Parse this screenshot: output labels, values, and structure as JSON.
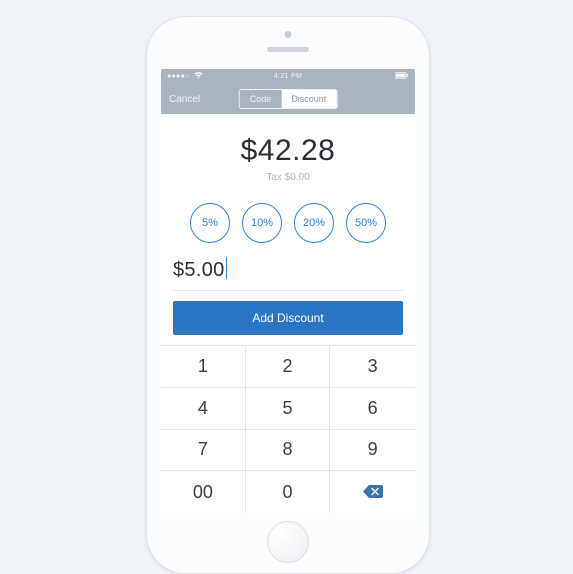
{
  "status": {
    "signal": "●●●●○",
    "wifi": "⚞",
    "time": "4:21 PM",
    "battery": "▮"
  },
  "nav": {
    "cancel": "Cancel",
    "seg_code": "Code",
    "seg_discount": "Discount"
  },
  "amount": {
    "total": "$42.28",
    "tax_label": "Tax $0.00"
  },
  "percents": [
    "5%",
    "10%",
    "20%",
    "50%"
  ],
  "discount_input": "$5.00",
  "add_button": "Add Discount",
  "keypad": {
    "r1": [
      "1",
      "2",
      "3"
    ],
    "r2": [
      "4",
      "5",
      "6"
    ],
    "r3": [
      "7",
      "8",
      "9"
    ],
    "r4": [
      "00",
      "0",
      ""
    ]
  },
  "colors": {
    "accent": "#2f81d6",
    "primary_button": "#2a76c2",
    "header": "#a9b4be"
  }
}
